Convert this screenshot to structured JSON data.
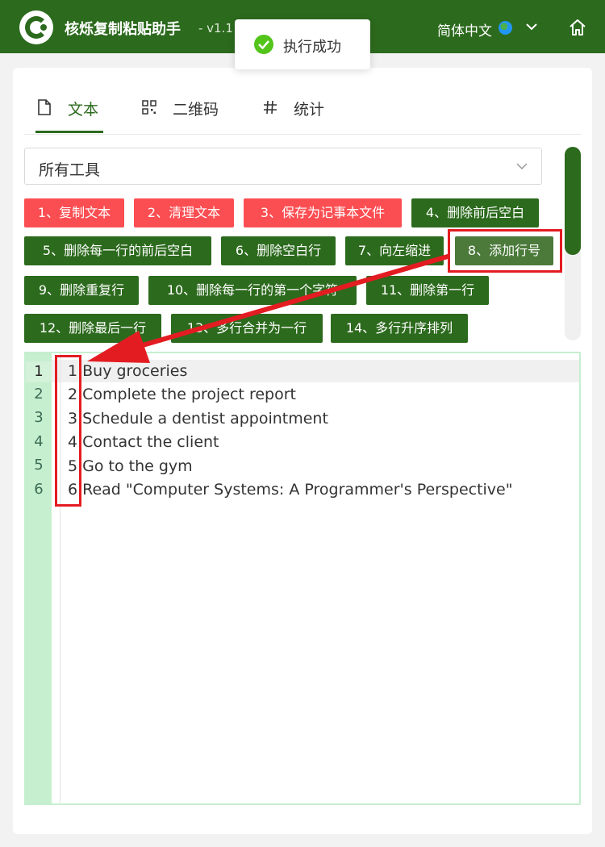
{
  "header": {
    "app_title": "核烁复制粘贴助手",
    "version": "- v1.1",
    "language": "简体中文"
  },
  "toast": {
    "message": "执行成功"
  },
  "tabs": [
    {
      "label": "文本",
      "active": true
    },
    {
      "label": "二维码",
      "active": false
    },
    {
      "label": "统计",
      "active": false
    }
  ],
  "tool_select": {
    "value": "所有工具"
  },
  "tools": [
    {
      "label": "1、复制文本",
      "color": "#fb4e52"
    },
    {
      "label": "2、清理文本",
      "color": "#fb4e52"
    },
    {
      "label": "3、保存为记事本文件",
      "color": "#fb4e52"
    },
    {
      "label": "4、删除前后空白",
      "color": "#2c6a1d"
    },
    {
      "label": "5、删除每一行的前后空白",
      "color": "#2c6a1d"
    },
    {
      "label": "6、删除空白行",
      "color": "#2c6a1d"
    },
    {
      "label": "7、向左缩进",
      "color": "#2c6a1d"
    },
    {
      "label": "8、添加行号",
      "color": "#4b7a3a"
    },
    {
      "label": "9、删除重复行",
      "color": "#2c6a1d"
    },
    {
      "label": "10、删除每一行的第一个字符",
      "color": "#2c6a1d"
    },
    {
      "label": "11、删除第一行",
      "color": "#2c6a1d"
    },
    {
      "label": "12、删除最后一行",
      "color": "#2c6a1d"
    },
    {
      "label": "13、多行合并为一行",
      "color": "#2c6a1d"
    },
    {
      "label": "14、多行升序排列",
      "color": "#2c6a1d"
    }
  ],
  "editor": {
    "line_numbers": [
      "1",
      "2",
      "3",
      "4",
      "5",
      "6"
    ],
    "lines": [
      "1.Buy groceries",
      "2.Complete the project report",
      "3.Schedule a dentist appointment",
      "4.Contact the client",
      "5.Go to the gym",
      "6.Read \"Computer Systems: A Programmer's Perspective\""
    ]
  },
  "colors": {
    "brand_green": "#2c6a1d",
    "danger_red": "#fb4e52",
    "annotation_red": "#e31c22",
    "gutter_green": "#c6efcf"
  }
}
